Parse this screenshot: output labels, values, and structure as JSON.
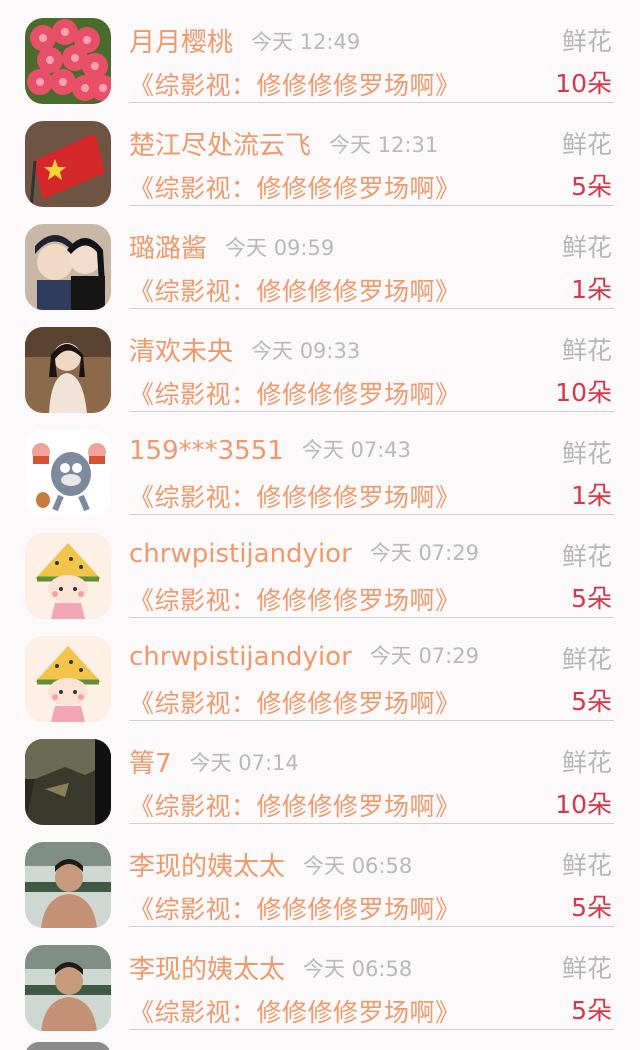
{
  "entries": [
    {
      "user": "月月樱桃",
      "time": "今天 12:49",
      "label": "鲜花",
      "book": "《综影视：修修修修罗场啊》",
      "count": "10朵",
      "avatar_icon": "red-flowers-avatar-icon"
    },
    {
      "user": "楚江尽处流云飞",
      "time": "今天 12:31",
      "label": "鲜花",
      "book": "《综影视：修修修修罗场啊》",
      "count": "5朵",
      "avatar_icon": "flag-avatar-icon"
    },
    {
      "user": "璐潞酱",
      "time": "今天 09:59",
      "label": "鲜花",
      "book": "《综影视：修修修修罗场啊》",
      "count": "1朵",
      "avatar_icon": "anime-avatar-icon"
    },
    {
      "user": "清欢未央",
      "time": "今天 09:33",
      "label": "鲜花",
      "book": "《综影视：修修修修罗场啊》",
      "count": "10朵",
      "avatar_icon": "portrait-avatar-icon"
    },
    {
      "user": "159***3551",
      "time": "今天 07:43",
      "label": "鲜花",
      "book": "《综影视：修修修修罗场啊》",
      "count": "1朵",
      "avatar_icon": "cartoon-cat-avatar-icon"
    },
    {
      "user": "chrwpistijandyior",
      "time": "今天 07:29",
      "label": "鲜花",
      "book": "《综影视：修修修修罗场啊》",
      "count": "5朵",
      "avatar_icon": "watermelon-girl-avatar-icon"
    },
    {
      "user": "chrwpistijandyior",
      "time": "今天 07:29",
      "label": "鲜花",
      "book": "《综影视：修修修修罗场啊》",
      "count": "5朵",
      "avatar_icon": "watermelon-girl-avatar-icon"
    },
    {
      "user": "箐7",
      "time": "今天 07:14",
      "label": "鲜花",
      "book": "《综影视：修修修修罗场啊》",
      "count": "10朵",
      "avatar_icon": "dark-scene-avatar-icon"
    },
    {
      "user": "李现的姨太太",
      "time": "今天 06:58",
      "label": "鲜花",
      "book": "《综影视：修修修修罗场啊》",
      "count": "5朵",
      "avatar_icon": "man-photo-avatar-icon"
    },
    {
      "user": "李现的姨太太",
      "time": "今天 06:58",
      "label": "鲜花",
      "book": "《综影视：修修修修罗场啊》",
      "count": "5朵",
      "avatar_icon": "man-photo-avatar-icon"
    }
  ],
  "colors": {
    "accent": "#ef9a6c",
    "count": "#d9364a",
    "muted": "#b7b7b7",
    "background": "#fbf9f9"
  }
}
